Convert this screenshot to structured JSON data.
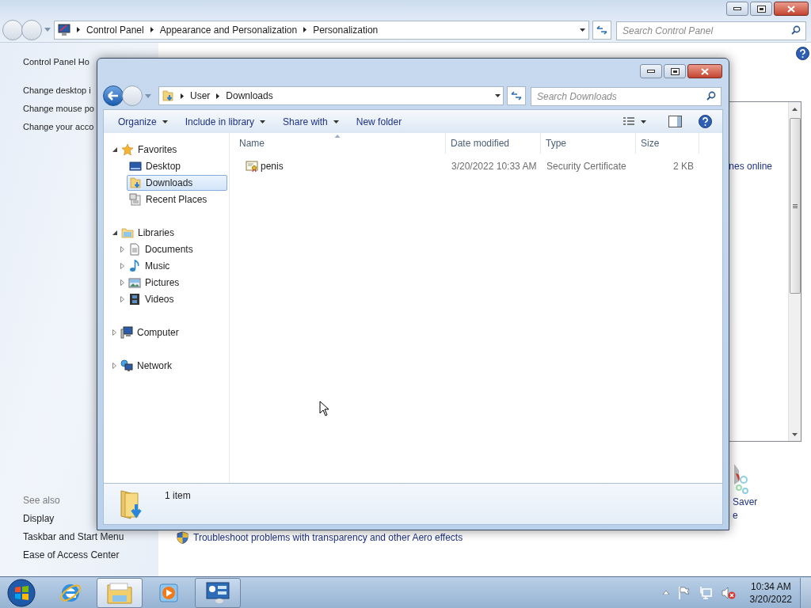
{
  "control_panel": {
    "breadcrumb": [
      "Control Panel",
      "Appearance and Personalization",
      "Personalization"
    ],
    "search": {
      "placeholder": "Search Control Panel"
    },
    "sidebar": {
      "links": [
        "Control Panel Ho",
        "Change desktop i",
        "Change mouse po",
        "Change your acco"
      ],
      "see_also": {
        "heading": "See also",
        "links": [
          "Display",
          "Taskbar and Start Menu",
          "Ease of Access Center"
        ]
      }
    },
    "content": {
      "link_fragment": "nes online",
      "icon_label_lines": [
        "Saver",
        "e"
      ],
      "troubleshoot_link": "Troubleshoot problems with transparency and other Aero effects"
    }
  },
  "explorer": {
    "breadcrumb": [
      "User",
      "Downloads"
    ],
    "search": {
      "placeholder": "Search Downloads"
    },
    "toolbar": [
      {
        "label": "Organize",
        "dropdown": true
      },
      {
        "label": "Include in library",
        "dropdown": true
      },
      {
        "label": "Share with",
        "dropdown": true
      },
      {
        "label": "New folder",
        "dropdown": false
      }
    ],
    "nav": [
      {
        "label": "Favorites",
        "kind": "favorites",
        "expanded": true,
        "selected": false,
        "children": [
          {
            "label": "Desktop",
            "kind": "desktop",
            "selected": false
          },
          {
            "label": "Downloads",
            "kind": "downloads",
            "selected": true
          },
          {
            "label": "Recent Places",
            "kind": "recent",
            "selected": false
          }
        ]
      },
      {
        "label": "Libraries",
        "kind": "libraries",
        "expanded": true,
        "selected": false,
        "children": [
          {
            "label": "Documents",
            "kind": "documents",
            "expanded": false,
            "selected": false
          },
          {
            "label": "Music",
            "kind": "music",
            "expanded": false,
            "selected": false
          },
          {
            "label": "Pictures",
            "kind": "pictures",
            "expanded": false,
            "selected": false
          },
          {
            "label": "Videos",
            "kind": "videos",
            "expanded": false,
            "selected": false
          }
        ]
      },
      {
        "label": "Computer",
        "kind": "computer",
        "expanded": false,
        "selected": false
      },
      {
        "label": "Network",
        "kind": "network",
        "expanded": false,
        "selected": false
      }
    ],
    "columns": [
      {
        "label": "Name",
        "sorted": true
      },
      {
        "label": "Date modified",
        "sorted": false
      },
      {
        "label": "Type",
        "sorted": false
      },
      {
        "label": "Size",
        "sorted": false
      }
    ],
    "files": [
      {
        "name": "penis",
        "date_modified": "3/20/2022 10:33 AM",
        "type": "Security Certificate",
        "size": "2 KB",
        "selected": false
      }
    ],
    "status": "1 item"
  },
  "taskbar": {
    "apps": [
      {
        "kind": "browser",
        "active": false,
        "open": false
      },
      {
        "kind": "explorer",
        "active": true,
        "open": true
      },
      {
        "kind": "media",
        "active": false,
        "open": false
      },
      {
        "kind": "control-panel",
        "active": false,
        "open": true
      }
    ],
    "tray": {
      "volume_muted": true
    },
    "clock": {
      "time": "10:34 AM",
      "date": "3/20/2022"
    }
  }
}
